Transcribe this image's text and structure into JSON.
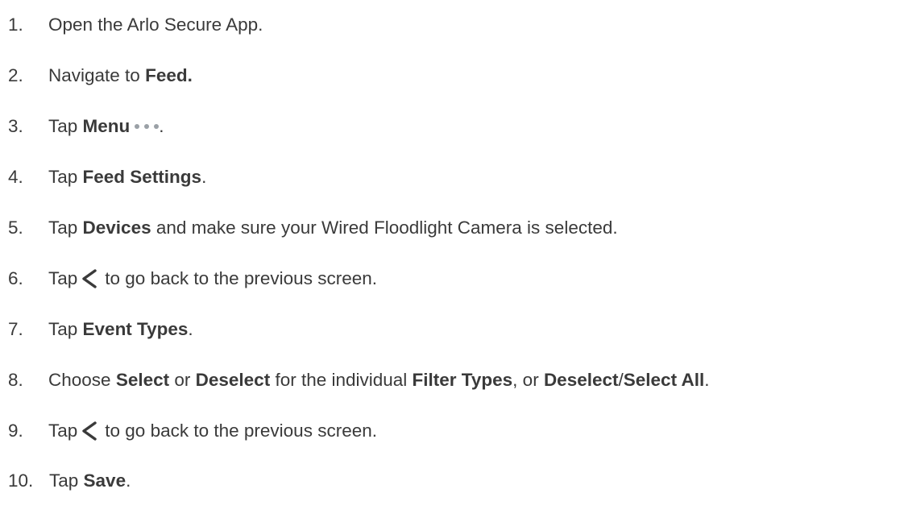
{
  "steps": [
    {
      "number": "1.",
      "parts": [
        {
          "text": "Open the Arlo Secure App.",
          "bold": false
        }
      ]
    },
    {
      "number": "2.",
      "parts": [
        {
          "text": "Navigate to ",
          "bold": false
        },
        {
          "text": "Feed.",
          "bold": true
        }
      ]
    },
    {
      "number": "3.",
      "parts": [
        {
          "text": "Tap ",
          "bold": false
        },
        {
          "text": "Menu",
          "bold": true
        },
        {
          "icon": "more-dots-icon"
        },
        {
          "text": ".",
          "bold": false
        }
      ]
    },
    {
      "number": "4.",
      "parts": [
        {
          "text": "Tap ",
          "bold": false
        },
        {
          "text": "Feed Settings",
          "bold": true
        },
        {
          "text": ".",
          "bold": false
        }
      ]
    },
    {
      "number": "5.",
      "parts": [
        {
          "text": "Tap ",
          "bold": false
        },
        {
          "text": "Devices",
          "bold": true
        },
        {
          "text": " and make sure your Wired Floodlight Camera is selected.",
          "bold": false
        }
      ]
    },
    {
      "number": "6.",
      "parts": [
        {
          "text": "Tap",
          "bold": false
        },
        {
          "icon": "chevron-left-icon"
        },
        {
          "text": "to go back to the previous screen.",
          "bold": false
        }
      ]
    },
    {
      "number": "7.",
      "parts": [
        {
          "text": "Tap ",
          "bold": false
        },
        {
          "text": "Event Types",
          "bold": true
        },
        {
          "text": ".",
          "bold": false
        }
      ]
    },
    {
      "number": "8.",
      "parts": [
        {
          "text": "Choose ",
          "bold": false
        },
        {
          "text": "Select",
          "bold": true
        },
        {
          "text": " or ",
          "bold": false
        },
        {
          "text": "Deselect",
          "bold": true
        },
        {
          "text": " for the individual ",
          "bold": false
        },
        {
          "text": "Filter Types",
          "bold": true
        },
        {
          "text": ", or ",
          "bold": false
        },
        {
          "text": "Deselect",
          "bold": true
        },
        {
          "text": "/",
          "bold": false
        },
        {
          "text": "Select All",
          "bold": true
        },
        {
          "text": ".",
          "bold": false
        }
      ]
    },
    {
      "number": "9.",
      "parts": [
        {
          "text": "Tap",
          "bold": false
        },
        {
          "icon": "chevron-left-icon"
        },
        {
          "text": "to go back to the previous screen.",
          "bold": false
        }
      ]
    },
    {
      "number": "10.",
      "parts": [
        {
          "text": "Tap ",
          "bold": false
        },
        {
          "text": "Save",
          "bold": true
        },
        {
          "text": ".",
          "bold": false
        }
      ]
    }
  ]
}
